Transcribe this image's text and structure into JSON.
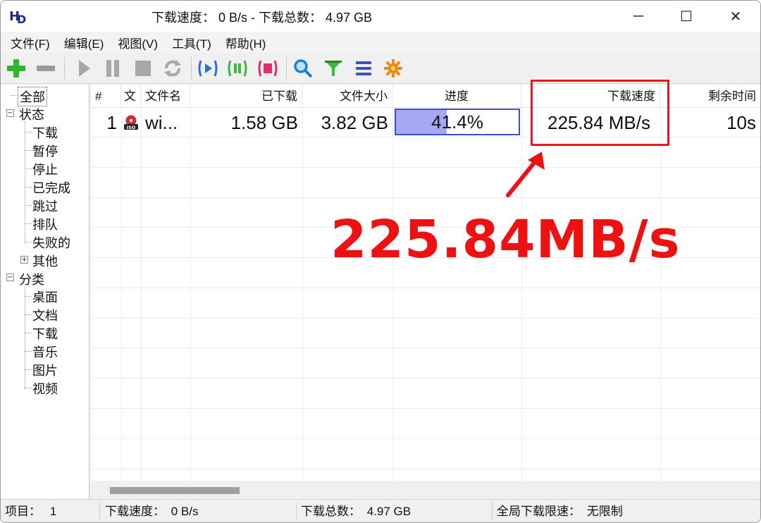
{
  "titlebar": {
    "title": "下载速度： 0 B/s - 下载总数： 4.97 GB",
    "minimize": "─",
    "maximize": "☐",
    "close": "✕"
  },
  "menu": [
    "文件(F)",
    "编辑(E)",
    "视图(V)",
    "工具(T)",
    "帮助(H)"
  ],
  "toolbar_icons": [
    "add-icon",
    "remove-icon",
    "start-icon",
    "pause-icon",
    "stop-icon",
    "refresh-icon",
    "start-all-icon",
    "pause-all-icon",
    "stop-all-icon",
    "search-icon",
    "filter-icon",
    "list-icon",
    "settings-gear-icon"
  ],
  "tree": {
    "all": "全部",
    "status": "状态",
    "status_items": [
      "下载",
      "暂停",
      "停止",
      "已完成",
      "跳过",
      "排队",
      "失败的"
    ],
    "other": "其他",
    "category": "分类",
    "category_items": [
      "桌面",
      "文档",
      "下载",
      "音乐",
      "图片",
      "视频"
    ]
  },
  "columns": {
    "num": "#",
    "type": "文",
    "name": "文件名",
    "downloaded": "已下载",
    "size": "文件大小",
    "progress": "进度",
    "speed": "下载速度",
    "remaining": "剩余时间"
  },
  "rows": [
    {
      "num": "1",
      "type_badge": "ISO",
      "name": "wi...",
      "downloaded": "1.58 GB",
      "size": "3.82 GB",
      "progress_text": "41.4%",
      "progress": 0.414,
      "speed": "225.84 MB/s",
      "remaining": "10s"
    }
  ],
  "annotation": {
    "big_text": "225.84MB/s",
    "color": "#ee1111"
  },
  "statusbar": {
    "items_label": "项目：",
    "items_value": "1",
    "speed_label": "下载速度：",
    "speed_value": "0 B/s",
    "total_label": "下载总数：",
    "total_value": "4.97 GB",
    "limit_label": "全局下载限速：",
    "limit_value": "无限制"
  }
}
